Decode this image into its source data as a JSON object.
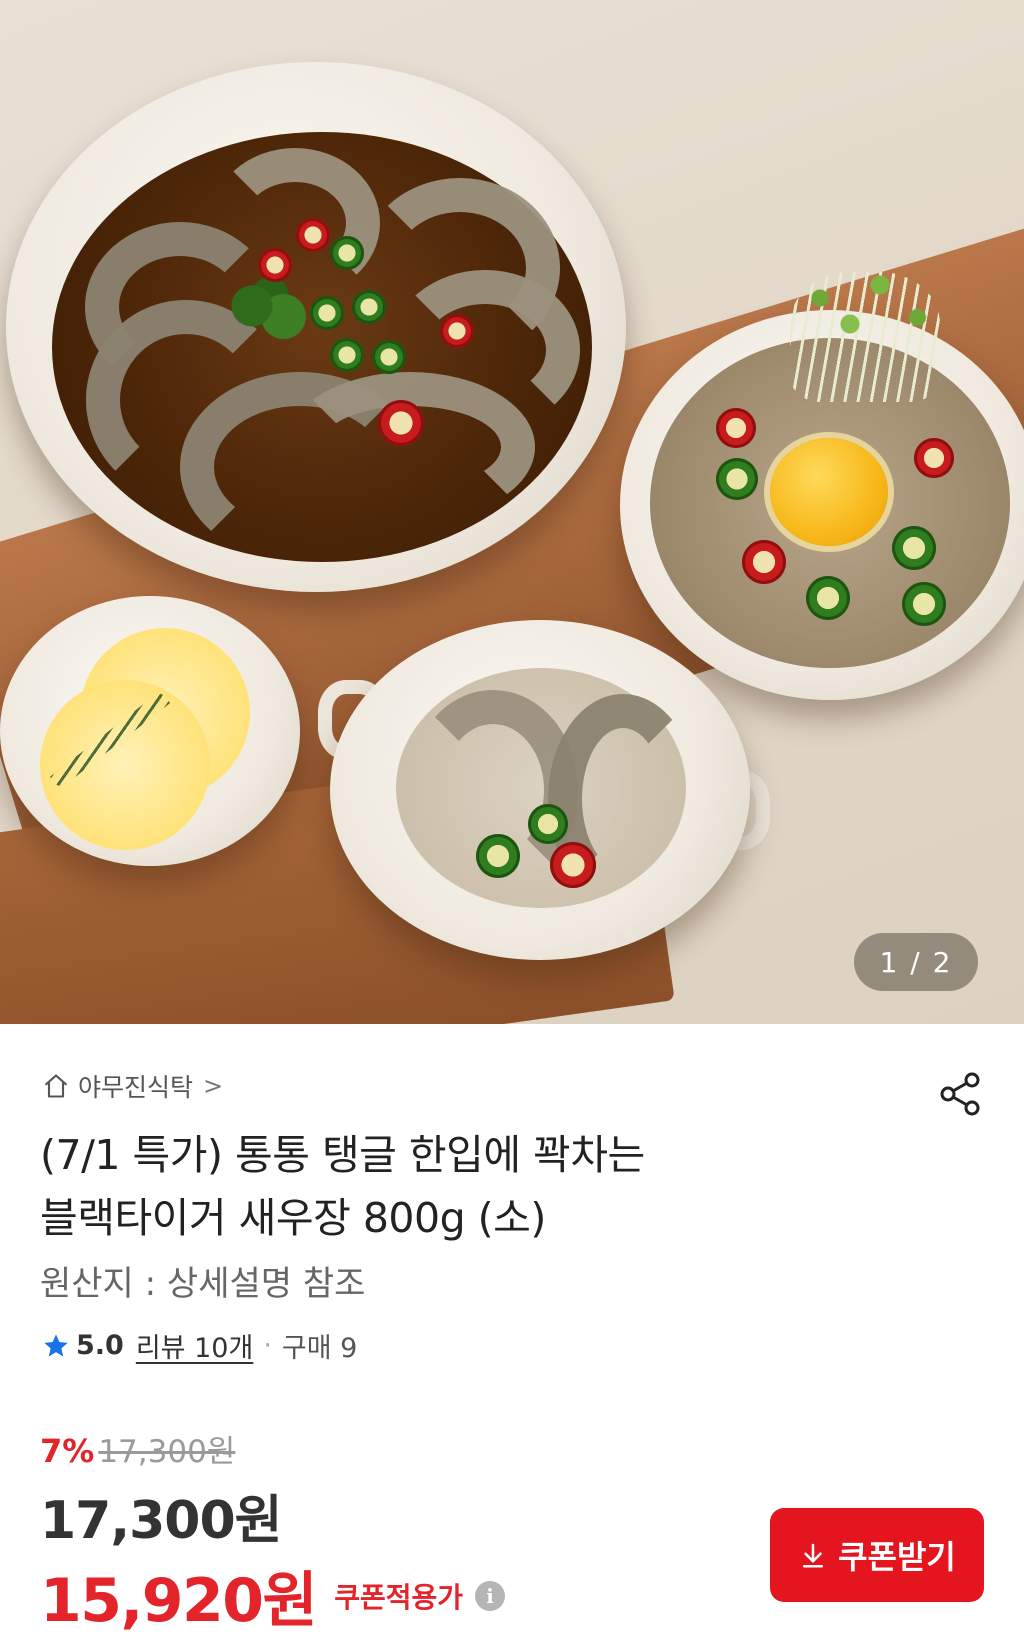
{
  "gallery": {
    "counter": "1 / 2"
  },
  "store": {
    "name": "야무진식탁",
    "chevron": ">"
  },
  "product": {
    "title_line1": "(7/1 특가) 통통 탱글 한입에 꽉차는",
    "title_line2": "블랙타이거 새우장 800g (소)",
    "origin": "원산지 : 상세설명 참조"
  },
  "rating": {
    "score": "5.0",
    "reviews": "리뷰 10개",
    "separator": "·",
    "purchases": "구매 9"
  },
  "pricing": {
    "discount_percent": "7%",
    "original_price": "17,300원",
    "price": "17,300원",
    "coupon_price": "15,920원",
    "coupon_label": "쿠폰적용가",
    "info_glyph": "i"
  },
  "coupon_button": {
    "label": "쿠폰받기"
  },
  "icons": {
    "home": "home-icon",
    "share": "share-icon",
    "star": "star-icon",
    "info": "info-icon",
    "download": "download-icon"
  },
  "colors": {
    "accent": "#e4151e",
    "star": "#1a73e8",
    "text": "#222222",
    "muted": "#9a9a9a"
  }
}
